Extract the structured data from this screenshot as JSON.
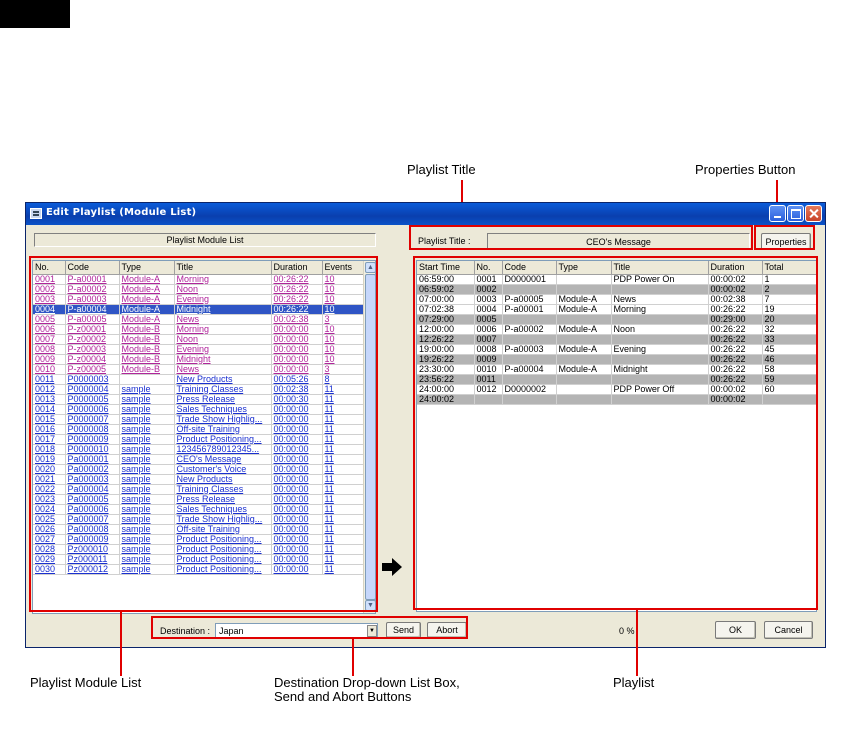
{
  "annotations": {
    "playlist_title": "Playlist Title",
    "properties_button": "Properties Button",
    "playlist_module_list": "Playlist Module List",
    "destination_line1": "Destination Drop-down List Box,",
    "destination_line2": "Send and Abort Buttons",
    "playlist": "Playlist"
  },
  "window": {
    "title": "Edit Playlist (Module List)"
  },
  "module_panel": {
    "label": "Playlist Module List",
    "columns": [
      "No.",
      "Code",
      "Type",
      "Title",
      "Duration",
      "Events"
    ],
    "rows": [
      {
        "no": "0001",
        "code": "P-a00001",
        "type": "Module-A",
        "title": "Morning",
        "duration": "00:26:22",
        "events": "10",
        "kind": "mod-a"
      },
      {
        "no": "0002",
        "code": "P-a00002",
        "type": "Module-A",
        "title": "Noon",
        "duration": "00:26:22",
        "events": "10",
        "kind": "mod-a"
      },
      {
        "no": "0003",
        "code": "P-a00003",
        "type": "Module-A",
        "title": "Evening",
        "duration": "00:26:22",
        "events": "10",
        "kind": "mod-a"
      },
      {
        "no": "0004",
        "code": "P-a00004",
        "type": "Module-A",
        "title": "Midnight",
        "duration": "00:26:22",
        "events": "10",
        "kind": "selected"
      },
      {
        "no": "0005",
        "code": "P-a00005",
        "type": "Module-A",
        "title": "News",
        "duration": "00:02:38",
        "events": "3",
        "kind": "mod-a"
      },
      {
        "no": "0006",
        "code": "P-z00001",
        "type": "Module-B",
        "title": "Morning",
        "duration": "00:00:00",
        "events": "10",
        "kind": "mod-b"
      },
      {
        "no": "0007",
        "code": "P-z00002",
        "type": "Module-B",
        "title": "Noon",
        "duration": "00:00:00",
        "events": "10",
        "kind": "mod-b"
      },
      {
        "no": "0008",
        "code": "P-z00003",
        "type": "Module-B",
        "title": "Evening",
        "duration": "00:00:00",
        "events": "10",
        "kind": "mod-b"
      },
      {
        "no": "0009",
        "code": "P-z00004",
        "type": "Module-B",
        "title": "Midnight",
        "duration": "00:00:00",
        "events": "10",
        "kind": "mod-b"
      },
      {
        "no": "0010",
        "code": "P-z00005",
        "type": "Module-B",
        "title": "News",
        "duration": "00:00:00",
        "events": "3",
        "kind": "mod-b"
      },
      {
        "no": "0011",
        "code": "P0000003",
        "type": "",
        "title": "New Products",
        "duration": "00:05:26",
        "events": "8",
        "kind": "mod-s"
      },
      {
        "no": "0012",
        "code": "P0000004",
        "type": "sample",
        "title": "Training Classes",
        "duration": "00:02:38",
        "events": "11",
        "kind": "mod-s"
      },
      {
        "no": "0013",
        "code": "P0000005",
        "type": "sample",
        "title": "Press Release",
        "duration": "00:00:30",
        "events": "11",
        "kind": "mod-s"
      },
      {
        "no": "0014",
        "code": "P0000006",
        "type": "sample",
        "title": "Sales Techniques",
        "duration": "00:00:00",
        "events": "11",
        "kind": "mod-s"
      },
      {
        "no": "0015",
        "code": "P0000007",
        "type": "sample",
        "title": "Trade Show Highlig...",
        "duration": "00:00:00",
        "events": "11",
        "kind": "mod-s"
      },
      {
        "no": "0016",
        "code": "P0000008",
        "type": "sample",
        "title": "Off-site Training",
        "duration": "00:00:00",
        "events": "11",
        "kind": "mod-s"
      },
      {
        "no": "0017",
        "code": "P0000009",
        "type": "sample",
        "title": "Product Positioning...",
        "duration": "00:00:00",
        "events": "11",
        "kind": "mod-s"
      },
      {
        "no": "0018",
        "code": "P0000010",
        "type": "sample",
        "title": "123456789012345...",
        "duration": "00:00:00",
        "events": "11",
        "kind": "mod-s"
      },
      {
        "no": "0019",
        "code": "Pa000001",
        "type": "sample",
        "title": "CEO's Message",
        "duration": "00:00:00",
        "events": "11",
        "kind": "mod-s"
      },
      {
        "no": "0020",
        "code": "Pa000002",
        "type": "sample",
        "title": "Customer's Voice",
        "duration": "00:00:00",
        "events": "11",
        "kind": "mod-s"
      },
      {
        "no": "0021",
        "code": "Pa000003",
        "type": "sample",
        "title": "New Products",
        "duration": "00:00:00",
        "events": "11",
        "kind": "mod-s"
      },
      {
        "no": "0022",
        "code": "Pa000004",
        "type": "sample",
        "title": "Training Classes",
        "duration": "00:00:00",
        "events": "11",
        "kind": "mod-s"
      },
      {
        "no": "0023",
        "code": "Pa000005",
        "type": "sample",
        "title": "Press Release",
        "duration": "00:00:00",
        "events": "11",
        "kind": "mod-s"
      },
      {
        "no": "0024",
        "code": "Pa000006",
        "type": "sample",
        "title": "Sales Techniques",
        "duration": "00:00:00",
        "events": "11",
        "kind": "mod-s"
      },
      {
        "no": "0025",
        "code": "Pa000007",
        "type": "sample",
        "title": "Trade Show Highlig...",
        "duration": "00:00:00",
        "events": "11",
        "kind": "mod-s"
      },
      {
        "no": "0026",
        "code": "Pa000008",
        "type": "sample",
        "title": "Off-site Training",
        "duration": "00:00:00",
        "events": "11",
        "kind": "mod-s"
      },
      {
        "no": "0027",
        "code": "Pa000009",
        "type": "sample",
        "title": "Product Positioning...",
        "duration": "00:00:00",
        "events": "11",
        "kind": "mod-s"
      },
      {
        "no": "0028",
        "code": "Pz000010",
        "type": "sample",
        "title": "Product Positioning...",
        "duration": "00:00:00",
        "events": "11",
        "kind": "mod-s"
      },
      {
        "no": "0029",
        "code": "Pz000011",
        "type": "sample",
        "title": "Product Positioning...",
        "duration": "00:00:00",
        "events": "11",
        "kind": "mod-s"
      },
      {
        "no": "0030",
        "code": "Pz000012",
        "type": "sample",
        "title": "Product Positioning...",
        "duration": "00:00:00",
        "events": "11",
        "kind": "mod-s"
      }
    ]
  },
  "playlist_panel": {
    "title_label": "Playlist Title :",
    "title_value": "CEO's Message",
    "properties_label": "Properties",
    "columns": [
      "Start Time",
      "No.",
      "Code",
      "Type",
      "Title",
      "Duration",
      "Total"
    ],
    "rows": [
      {
        "start": "06:59:00",
        "no": "0001",
        "code": "D0000001",
        "type": "",
        "title": "PDP Power On",
        "duration": "00:00:02",
        "total": "1",
        "gap": false
      },
      {
        "start": "06:59:02",
        "no": "0002",
        "code": "",
        "type": "",
        "title": "",
        "duration": "00:00:02",
        "total": "2",
        "gap": true
      },
      {
        "start": "07:00:00",
        "no": "0003",
        "code": "P-a00005",
        "type": "Module-A",
        "title": "News",
        "duration": "00:02:38",
        "total": "7",
        "gap": false
      },
      {
        "start": "07:02:38",
        "no": "0004",
        "code": "P-a00001",
        "type": "Module-A",
        "title": "Morning",
        "duration": "00:26:22",
        "total": "19",
        "gap": false
      },
      {
        "start": "07:29:00",
        "no": "0005",
        "code": "",
        "type": "",
        "title": "",
        "duration": "00:29:00",
        "total": "20",
        "gap": true
      },
      {
        "start": "12:00:00",
        "no": "0006",
        "code": "P-a00002",
        "type": "Module-A",
        "title": "Noon",
        "duration": "00:26:22",
        "total": "32",
        "gap": false
      },
      {
        "start": "12:26:22",
        "no": "0007",
        "code": "",
        "type": "",
        "title": "",
        "duration": "00:26:22",
        "total": "33",
        "gap": true
      },
      {
        "start": "19:00:00",
        "no": "0008",
        "code": "P-a00003",
        "type": "Module-A",
        "title": "Evening",
        "duration": "00:26:22",
        "total": "45",
        "gap": false
      },
      {
        "start": "19:26:22",
        "no": "0009",
        "code": "",
        "type": "",
        "title": "",
        "duration": "00:26:22",
        "total": "46",
        "gap": true
      },
      {
        "start": "23:30:00",
        "no": "0010",
        "code": "P-a00004",
        "type": "Module-A",
        "title": "Midnight",
        "duration": "00:26:22",
        "total": "58",
        "gap": false
      },
      {
        "start": "23:56:22",
        "no": "0011",
        "code": "",
        "type": "",
        "title": "",
        "duration": "00:26:22",
        "total": "59",
        "gap": true
      },
      {
        "start": "24:00:00",
        "no": "0012",
        "code": "D0000002",
        "type": "",
        "title": "PDP Power Off",
        "duration": "00:00:02",
        "total": "60",
        "gap": false
      },
      {
        "start": "24:00:02",
        "no": "",
        "code": "",
        "type": "",
        "title": "",
        "duration": "00:00:02",
        "total": "",
        "gap": true
      }
    ]
  },
  "bottom": {
    "destination_label": "Destination :",
    "destination_value": "Japan",
    "send_label": "Send",
    "abort_label": "Abort",
    "progress": "0 %",
    "ok_label": "OK",
    "cancel_label": "Cancel"
  },
  "colors": {
    "callout_red": "#e00000",
    "module_text": "#b0249b",
    "sample_text": "#1a2fd0",
    "selected_row": "#2f55c5",
    "gap_row": "#b4b4b4"
  }
}
